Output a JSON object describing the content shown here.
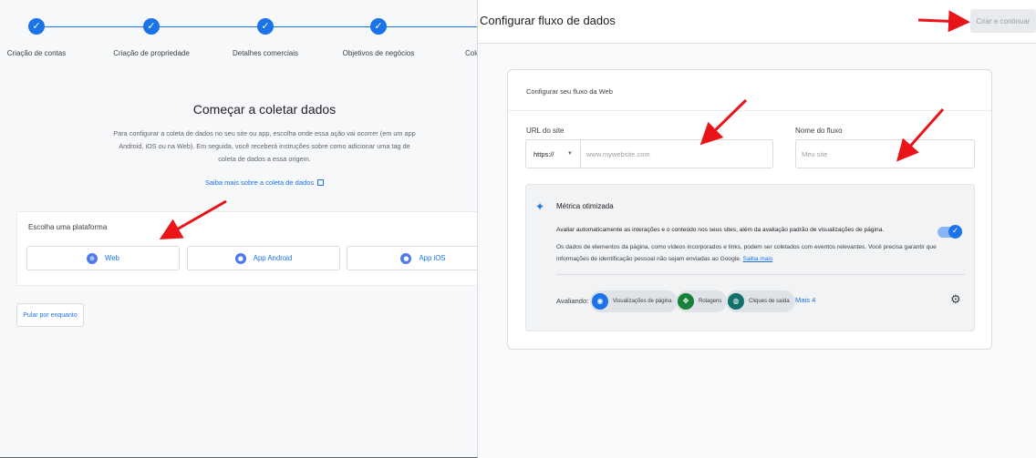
{
  "left": {
    "steps": [
      {
        "label": "Criação de contas",
        "check": "✓"
      },
      {
        "label": "Criação de propriedade",
        "check": "✓"
      },
      {
        "label": "Detalhes comerciais",
        "check": "✓"
      },
      {
        "label": "Objetivos de negócios",
        "check": "✓"
      },
      {
        "label": "Cole",
        "check": "✓"
      }
    ],
    "title": "Começar a coletar dados",
    "description": "Para configurar a coleta de dados no seu site ou app, escolha onde essa ação vai ocorrer (em um app Android, iOS ou na Web). Em seguida, você receberá instruções sobre como adicionar uma tag de coleta de dados a essa origem.",
    "learn_more": "Saiba mais sobre a coleta de dados",
    "platform_title": "Escolha uma plataforma",
    "platforms": [
      {
        "label": "Web",
        "icon": "globe-icon",
        "glyph": "⊕"
      },
      {
        "label": "App Android",
        "icon": "android-icon",
        "glyph": "●"
      },
      {
        "label": "App iOS",
        "icon": "apple-icon",
        "glyph": "●"
      }
    ],
    "skip": "Pular por enquanto"
  },
  "right": {
    "title": "Configurar fluxo de dados",
    "create_button": "Criar e continuar",
    "card_header": "Configurar seu fluxo da Web",
    "url_label": "URL do site",
    "protocol": "https://",
    "url_placeholder": "www.mywebsite.com",
    "name_label": "Nome do fluxo",
    "name_placeholder": "Meu site",
    "metric_title": "Métrica otimizada",
    "metric_line1": "Avaliar automaticamente as interações e o conteúdo nos seus sites, além da avaliação padrão de visualizações de página.",
    "metric_line2": "Os dados de elementos da página, como vídeos incorporados e links, podem ser coletados com eventos relevantes. Você precisa garantir que informações de identificação pessoal não sejam enviadas ao Google.",
    "metric_link": "Saiba mais",
    "eval_label": "Avaliando:",
    "chips": [
      {
        "label": "Visualizações de página",
        "color": "#1a73e8",
        "glyph": "◉"
      },
      {
        "label": "Rolagens",
        "color": "#188038",
        "glyph": "✥"
      },
      {
        "label": "Cliques de saída",
        "color": "#12706b",
        "glyph": "◍"
      }
    ],
    "more": "Mais 4",
    "toggle_on": true
  },
  "colors": {
    "accent": "#1a73e8",
    "arrow": "#e8141a"
  }
}
